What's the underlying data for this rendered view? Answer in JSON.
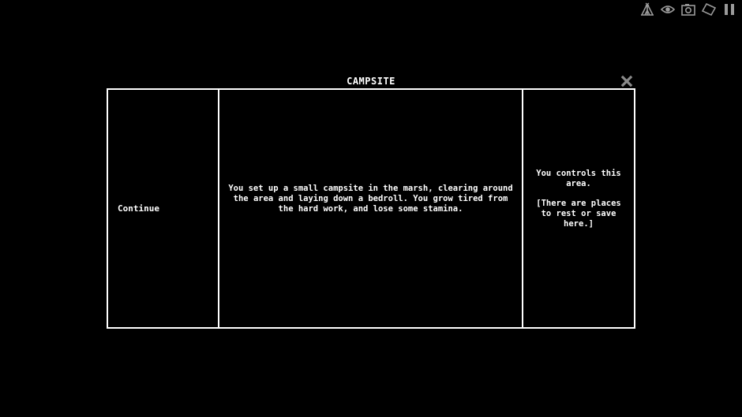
{
  "hud": {
    "icons": [
      "camp-tent-icon",
      "eye-icon",
      "camera-icon",
      "map-icon",
      "pause-icon"
    ]
  },
  "dialog": {
    "title": "CAMPSITE",
    "close_icon": "close-x-icon",
    "options": [
      {
        "label": "Continue"
      }
    ],
    "narration": "You set up a small campsite in the marsh, clearing around the area and laying down a bedroll. You grow tired from the hard work, and lose some stamina.",
    "area_info": {
      "control_text": "You controls this area.",
      "note_text": "[There are places to rest or save here.]"
    }
  },
  "colors": {
    "background": "#000000",
    "foreground": "#ffffff",
    "hud_icon": "#9a9a9a"
  }
}
